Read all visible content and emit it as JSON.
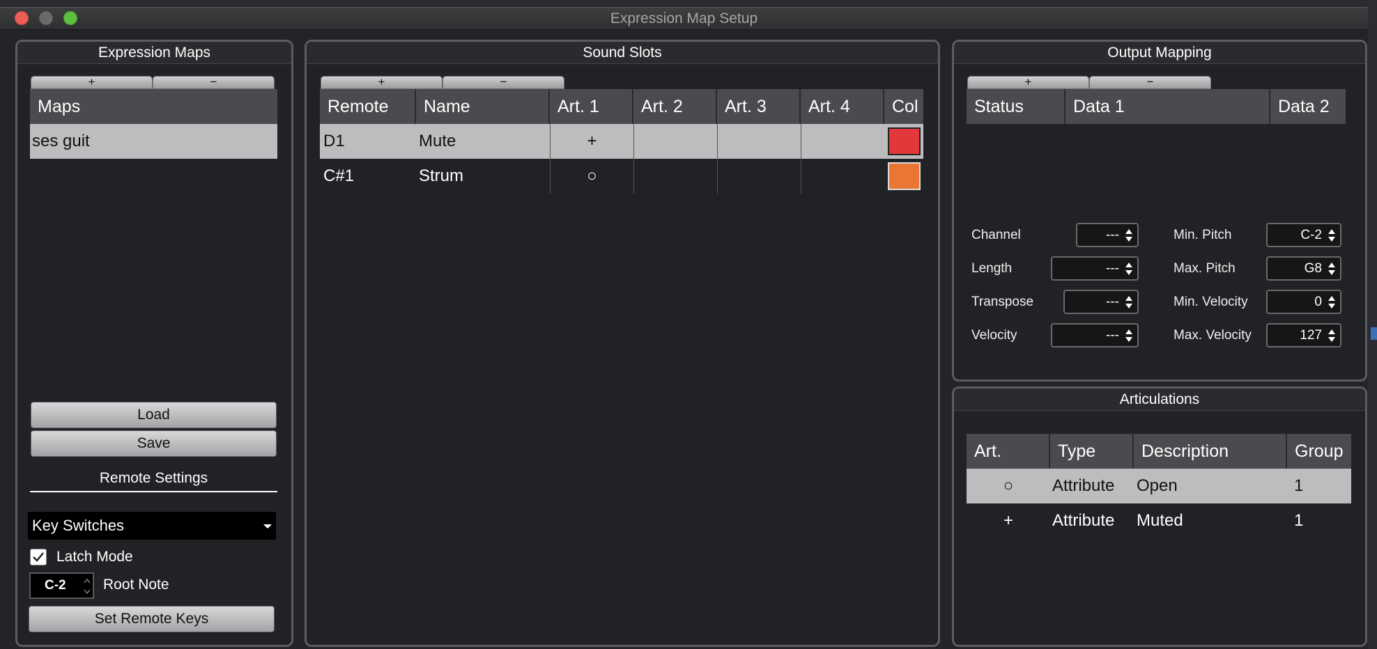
{
  "window": {
    "title": "Expression Map Setup"
  },
  "expression_maps": {
    "title": "Expression Maps",
    "plus": "+",
    "minus": "−",
    "header": "Maps",
    "items": [
      "ses guit"
    ],
    "load": "Load",
    "save": "Save"
  },
  "remote_settings": {
    "title": "Remote Settings",
    "mode": "Key Switches",
    "latch_label": "Latch Mode",
    "latch_checked": true,
    "root_value": "C-2",
    "root_label": "Root Note",
    "set_keys": "Set Remote Keys"
  },
  "sound_slots": {
    "title": "Sound Slots",
    "plus": "+",
    "minus": "−",
    "columns": [
      "Remote",
      "Name",
      "Art. 1",
      "Art. 2",
      "Art. 3",
      "Art. 4",
      "Col"
    ],
    "rows": [
      {
        "remote": "D1",
        "name": "Mute",
        "art1": "+",
        "color": "#e3373b"
      },
      {
        "remote": "C#1",
        "name": "Strum",
        "art1": "○",
        "color": "#ea7634"
      }
    ]
  },
  "output_mapping": {
    "title": "Output Mapping",
    "plus": "+",
    "minus": "−",
    "columns": [
      "Status",
      "Data 1",
      "Data 2"
    ],
    "fields": {
      "channel": {
        "label": "Channel",
        "value": "---"
      },
      "length": {
        "label": "Length",
        "value": "---"
      },
      "transpose": {
        "label": "Transpose",
        "value": "---"
      },
      "velocity": {
        "label": "Velocity",
        "value": "---"
      },
      "min_pitch": {
        "label": "Min. Pitch",
        "value": "C-2"
      },
      "max_pitch": {
        "label": "Max. Pitch",
        "value": "G8"
      },
      "min_velocity": {
        "label": "Min. Velocity",
        "value": "0"
      },
      "max_velocity": {
        "label": "Max. Velocity",
        "value": "127"
      }
    }
  },
  "articulations": {
    "title": "Articulations",
    "columns": [
      "Art.",
      "Type",
      "Description",
      "Group"
    ],
    "rows": [
      {
        "art": "○",
        "type": "Attribute",
        "description": "Open",
        "group": "1"
      },
      {
        "art": "+",
        "type": "Attribute",
        "description": "Muted",
        "group": "1"
      }
    ]
  }
}
